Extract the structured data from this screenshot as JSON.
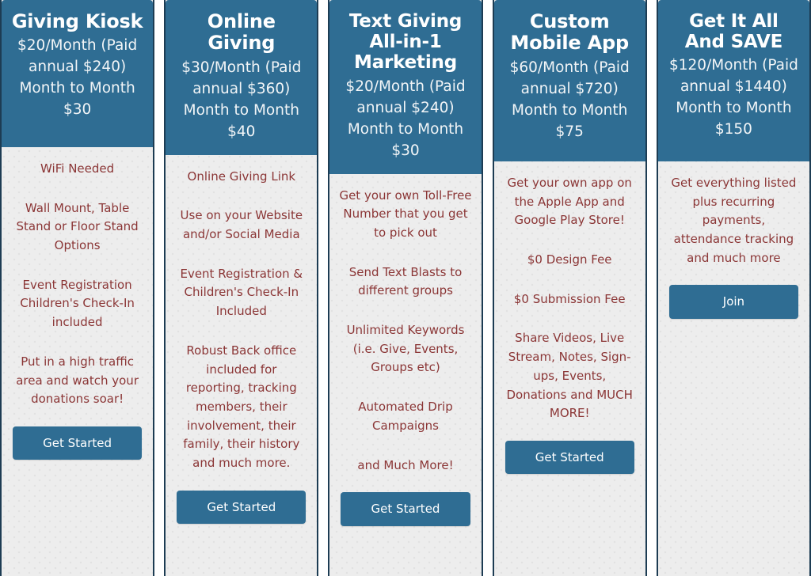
{
  "plans": [
    {
      "title": "Giving Kiosk",
      "price": "$20/Month (Paid annual $240) Month to Month $30",
      "features": [
        "WiFi Needed",
        "Wall Mount, Table Stand or Floor Stand Options",
        "Event Registration Children's Check-In included",
        "Put in a high traffic area and watch your donations soar!"
      ],
      "cta": "Get Started"
    },
    {
      "title": "Online Giving",
      "price": "$30/Month (Paid annual $360) Month to Month $40",
      "features": [
        "Online Giving Link",
        "Use on your Website and/or Social Media",
        "Event Registration & Children's Check-In Included",
        "Robust Back office included for reporting, tracking members, their involvement, their family, their history and much more."
      ],
      "cta": "Get Started"
    },
    {
      "title": "Text Giving All-in-1 Marketing",
      "price": "$20/Month (Paid annual $240) Month to Month $30",
      "features": [
        "Get your own Toll-Free Number that you get to pick out",
        "Send Text Blasts to different groups",
        "Unlimited Keywords (i.e. Give, Events, Groups etc)",
        "Automated Drip Campaigns",
        "and Much More!"
      ],
      "cta": "Get Started"
    },
    {
      "title": "Custom Mobile App",
      "price": "$60/Month (Paid annual $720) Month to Month $75",
      "features": [
        "Get your own app on the Apple App and Google Play Store!",
        "$0 Design Fee",
        "$0 Submission Fee",
        "Share Videos, Live Stream, Notes, Sign-ups, Events, Donations and MUCH MORE!"
      ],
      "cta": "Get Started"
    },
    {
      "title": "Get It All And SAVE",
      "price": "$120/Month (Paid annual $1440) Month to Month $150",
      "features": [
        "Get everything listed plus recurring payments, attendance tracking and much more"
      ],
      "cta": "Join"
    }
  ],
  "colors": {
    "header_background": "#2f6d93",
    "card_background": "#ededed",
    "card_border": "#1d3c53",
    "feature_text": "#8b3636",
    "header_text": "#ffffff",
    "button_background": "#2f6d93"
  }
}
